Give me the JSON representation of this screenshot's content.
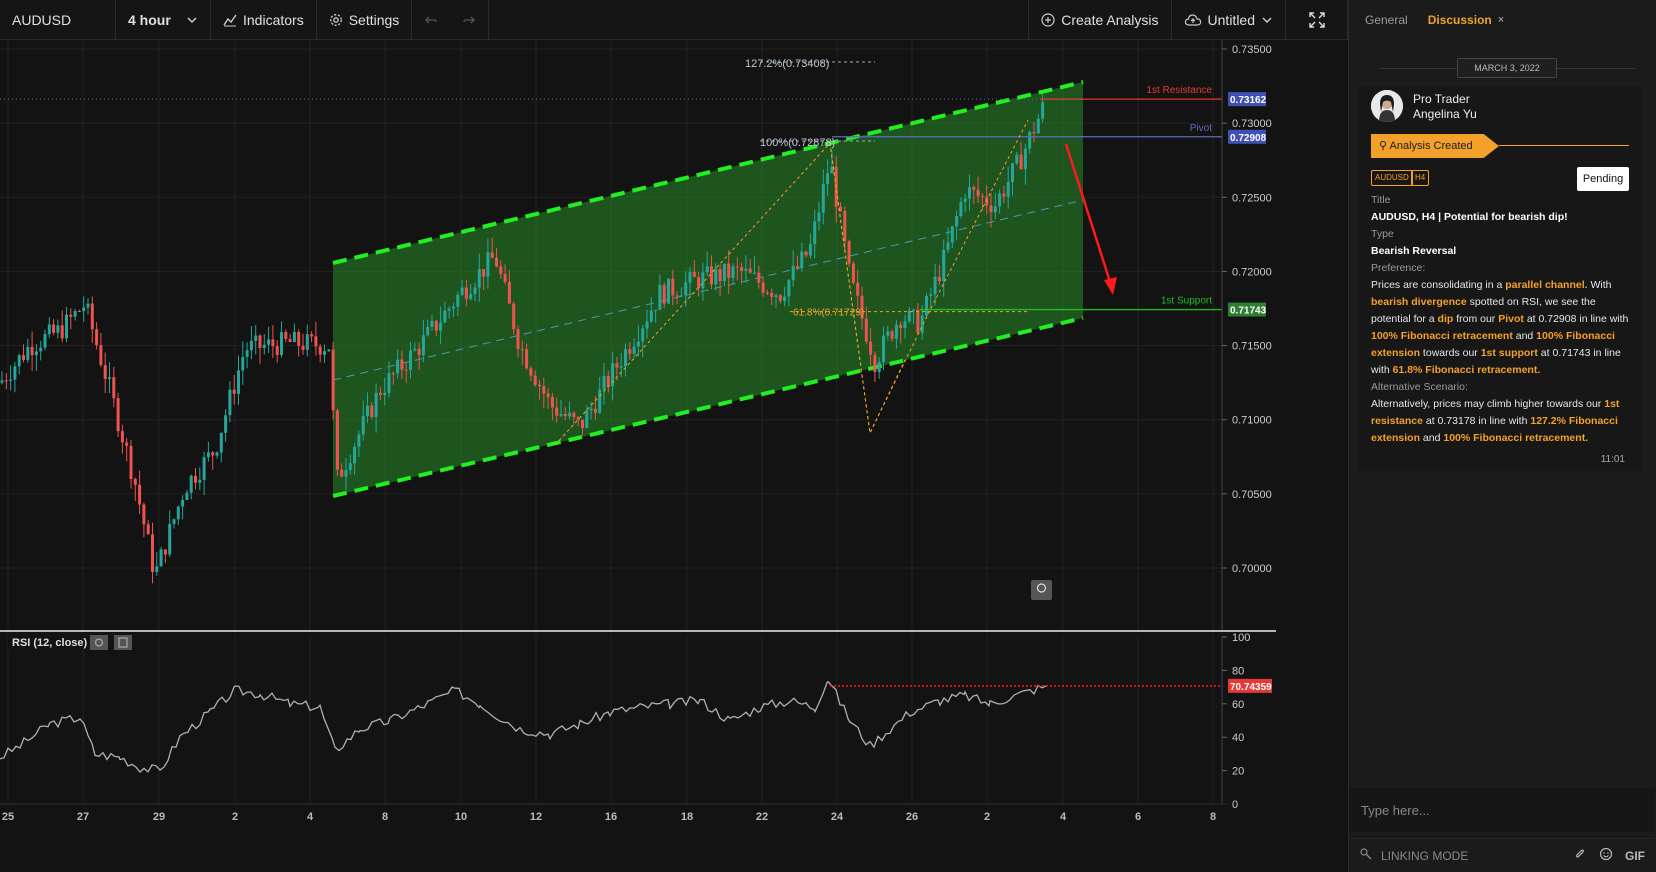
{
  "toolbar": {
    "symbol": "AUDUSD",
    "interval": "4 hour",
    "indicators": "Indicators",
    "settings": "Settings",
    "create_analysis": "Create Analysis",
    "layout_name": "Untitled"
  },
  "chart": {
    "price_levels": [
      {
        "price": 0.735,
        "label": "0.73500"
      },
      {
        "price": 0.73,
        "label": "0.73000"
      },
      {
        "price": 0.725,
        "label": "0.72500"
      },
      {
        "price": 0.72,
        "label": "0.72000"
      },
      {
        "price": 0.715,
        "label": "0.71500"
      },
      {
        "price": 0.71,
        "label": "0.71000"
      },
      {
        "price": 0.705,
        "label": "0.70500"
      },
      {
        "price": 0.7,
        "label": "0.70000"
      }
    ],
    "resistance": {
      "label": "1st Resistance",
      "price": 0.73162,
      "badge": "0.73162"
    },
    "pivot": {
      "label": "Pivot",
      "price": 0.72908,
      "badge": "0.72908"
    },
    "support": {
      "label": "1st Support",
      "price": 0.71743,
      "badge": "0.71743"
    },
    "fib_labels": {
      "ext_1272": "127.2%(0.73408)",
      "ext_100": "100%(0.72878)",
      "ret_618": "61.8%(0.71729)"
    },
    "x_labels": [
      "25",
      "27",
      "29",
      "2",
      "4",
      "8",
      "10",
      "12",
      "16",
      "18",
      "22",
      "24",
      "26",
      "2",
      "4",
      "6",
      "8"
    ],
    "colors": {
      "up": "#26a69a",
      "down": "#ef5350",
      "channel": "#22ee22",
      "resistance": "#e53935",
      "pivot": "#5c6bc0",
      "support": "#22bb22",
      "fib": "#f4a12b"
    }
  },
  "rsi": {
    "label": "RSI (12, close)",
    "value": 70.74359,
    "value_label": "70.74359",
    "levels": [
      "100",
      "80",
      "60",
      "40",
      "20",
      "0"
    ]
  },
  "panel": {
    "tab_general": "General",
    "tab_discussion": "Discussion",
    "close_glyph": "×",
    "date": "MARCH 3, 2022",
    "author_role": "Pro Trader",
    "author_name": "Angelina Yu",
    "status_banner": "Analysis Created",
    "tag_symbol": "AUDUSD",
    "tag_timeframe": "H4",
    "pending": "Pending",
    "title_label": "Title",
    "title": "AUDUSD, H4 | Potential for bearish dip!",
    "type_label": "Type",
    "type": "Bearish Reversal",
    "preference_label": "Preference:",
    "alt_label": "Alternative Scenario:",
    "time": "11:01",
    "input_placeholder": "Type here...",
    "linking_mode": "LINKING MODE",
    "gif": "GIF"
  }
}
